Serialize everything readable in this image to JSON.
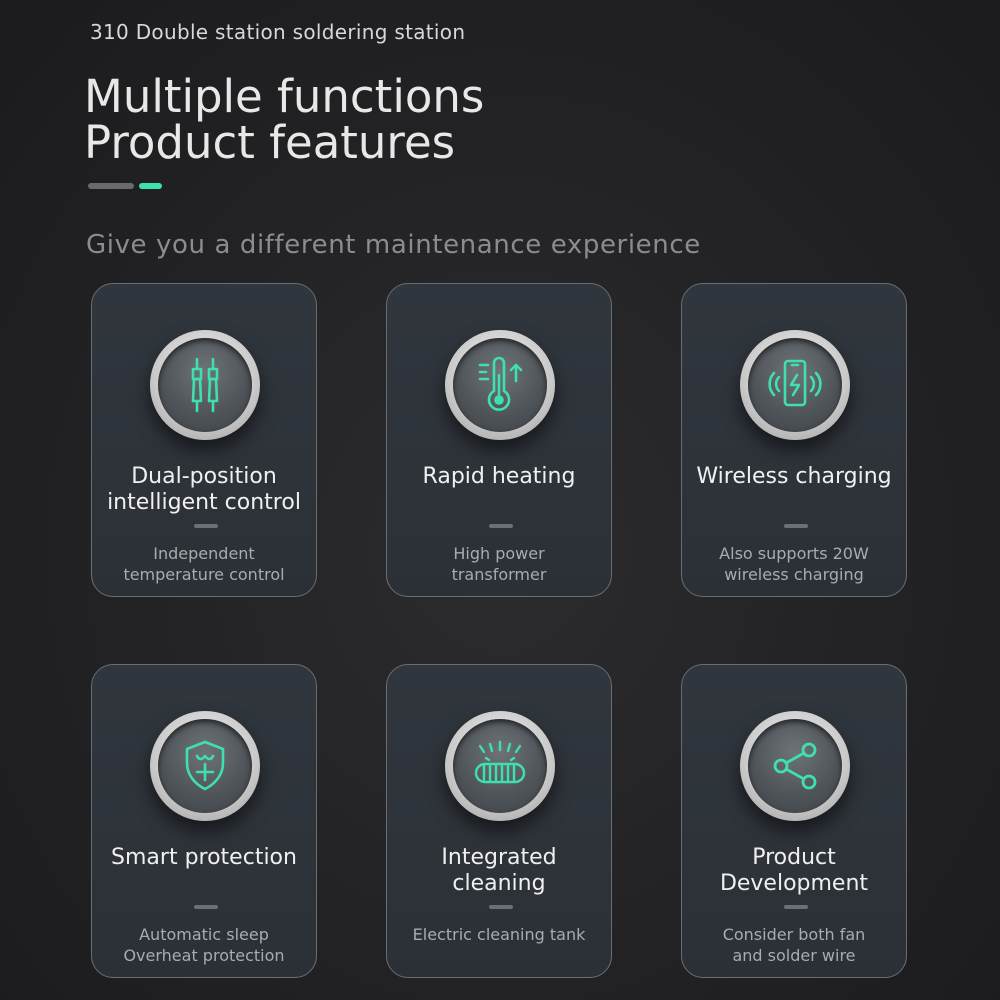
{
  "header": {
    "product_line": "310 Double station soldering station",
    "title_line1": "Multiple functions",
    "title_line2": "Product features",
    "tagline": "Give you a different maintenance experience"
  },
  "colors": {
    "accent_green": "#3fe0b0",
    "accent_gray": "#6a6a6c",
    "background": "#242426",
    "card_background": "#30363d"
  },
  "features": [
    {
      "icon": "soldering-irons-icon",
      "title_line1": "Dual-position",
      "title_line2": "intelligent control",
      "desc_line1": "Independent",
      "desc_line2": "temperature control"
    },
    {
      "icon": "thermometer-icon",
      "title_line1": "Rapid heating",
      "title_line2": "",
      "desc_line1": "High power",
      "desc_line2": "transformer"
    },
    {
      "icon": "wireless-charging-icon",
      "title_line1": "Wireless charging",
      "title_line2": "",
      "desc_line1": "Also supports 20W",
      "desc_line2": "wireless charging"
    },
    {
      "icon": "shield-icon",
      "title_line1": "Smart protection",
      "title_line2": "",
      "desc_line1": "Automatic sleep",
      "desc_line2": "Overheat protection"
    },
    {
      "icon": "cleaning-brush-icon",
      "title_line1": "Integrated",
      "title_line2": "cleaning",
      "desc_line1": "Electric cleaning tank",
      "desc_line2": ""
    },
    {
      "icon": "share-icon",
      "title_line1": "Product",
      "title_line2": "Development",
      "desc_line1": "Consider both fan",
      "desc_line2": "and solder wire"
    }
  ]
}
